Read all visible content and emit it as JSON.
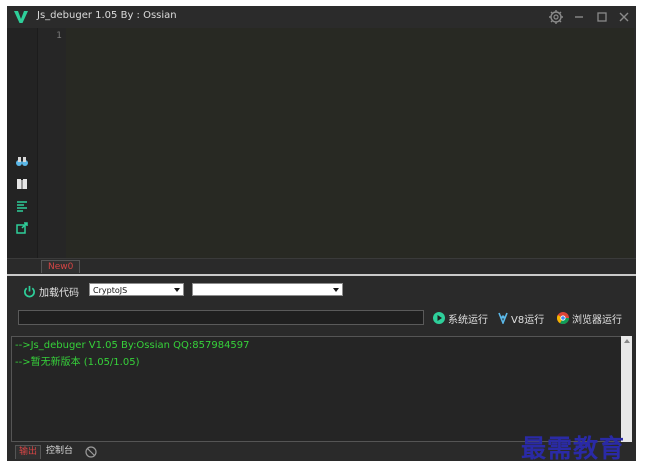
{
  "window": {
    "title": "Js_debuger 1.05 By : Ossian",
    "controls": [
      "settings",
      "minimize",
      "maximize",
      "close"
    ]
  },
  "colors": {
    "accent": "#2ecf9a",
    "console_text": "#36d13a",
    "active_tab": "#d64545",
    "background": "#2a2a2a"
  },
  "sidebar": {
    "icons": [
      "binoculars-icon",
      "book-icon",
      "list-icon",
      "external-link-icon"
    ]
  },
  "editor": {
    "line_numbers": [
      "1"
    ],
    "tabs": [
      {
        "label": "New0"
      }
    ]
  },
  "toolbar": {
    "load_code_label": "加载代码",
    "library_select": {
      "value": "CryptoJS"
    },
    "second_select": {
      "value": ""
    },
    "input": {
      "value": ""
    },
    "run_system_label": "系统运行",
    "run_v8_label": "V8运行",
    "run_browser_label": "浏览器运行"
  },
  "console": {
    "lines": [
      "-->Js_debuger V1.05 By:Ossian QQ:857984597",
      "-->暂无新版本 (1.05/1.05)"
    ],
    "tabs": [
      {
        "label": "输出"
      },
      {
        "label": "控制台"
      }
    ]
  },
  "watermark": {
    "text": "最需教育"
  }
}
